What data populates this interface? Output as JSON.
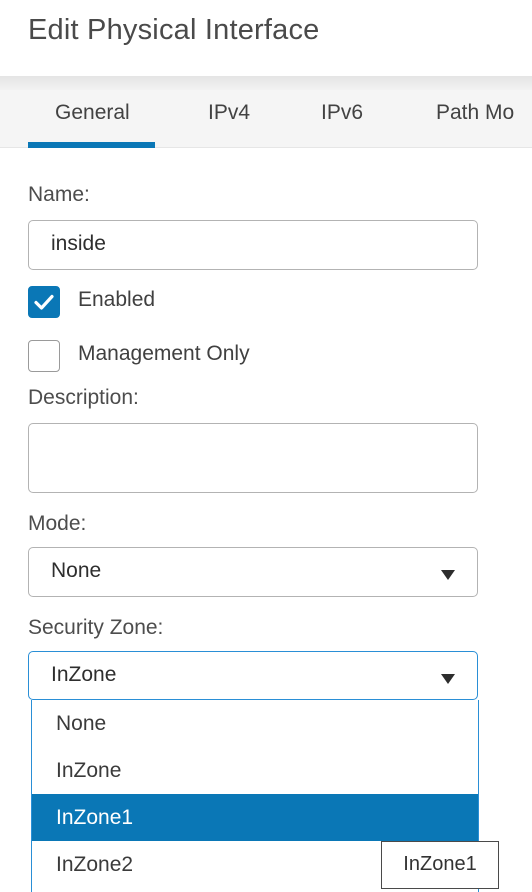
{
  "dialog": {
    "title": "Edit Physical Interface"
  },
  "tabs": [
    {
      "label": "General",
      "active": true
    },
    {
      "label": "IPv4",
      "active": false
    },
    {
      "label": "IPv6",
      "active": false
    },
    {
      "label": "Path Mo",
      "active": false
    }
  ],
  "form": {
    "name_label": "Name:",
    "name_value": "inside",
    "enabled_label": "Enabled",
    "enabled_checked": true,
    "management_only_label": "Management Only",
    "management_only_checked": false,
    "description_label": "Description:",
    "description_value": "",
    "mode_label": "Mode:",
    "mode_value": "None",
    "security_zone_label": "Security Zone:",
    "security_zone_value": "InZone"
  },
  "security_zone_dropdown": {
    "options": [
      "None",
      "InZone",
      "InZone1",
      "InZone2"
    ],
    "highlighted": "InZone1",
    "tooltip": "InZone1"
  },
  "colors": {
    "accent": "#0a77b6",
    "focus_border": "#2a8fd6"
  }
}
